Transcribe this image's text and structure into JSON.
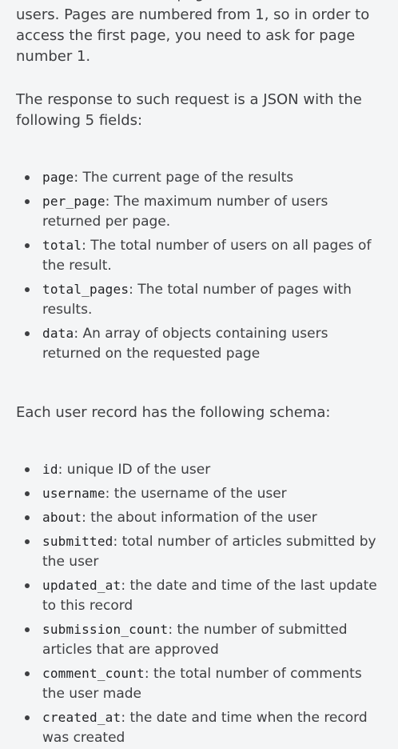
{
  "intro": {
    "pagination_text": "will return the second page of the collection of users. Pages are numbered from 1, so in order to access the first page, you need to ask for page number 1.",
    "response_text": "The response to such request is a JSON with the following 5 fields:"
  },
  "response_fields": [
    {
      "name": "page",
      "desc": ": The current page of the results"
    },
    {
      "name": "per_page",
      "desc": ": The maximum number of users returned per page."
    },
    {
      "name": "total",
      "desc": ": The total number of users on all pages of the result."
    },
    {
      "name": "total_pages",
      "desc": ": The total number of pages with results."
    },
    {
      "name": "data",
      "desc": ": An array of objects containing users returned on the requested page"
    }
  ],
  "schema_intro": "Each user record has the following schema:",
  "user_fields": [
    {
      "name": "id",
      "desc": ": unique ID of the user"
    },
    {
      "name": "username",
      "desc": ": the username of the user"
    },
    {
      "name": "about",
      "desc": ": the about information of the user"
    },
    {
      "name": "submitted",
      "desc": ": total number of articles submitted by the user"
    },
    {
      "name": "updated_at",
      "desc": ": the date and time of the last update to this record"
    },
    {
      "name": "submission_count",
      "desc": ": the number of submitted articles that are approved"
    },
    {
      "name": "comment_count",
      "desc": ": the total number of comments the user made"
    },
    {
      "name": "created_at",
      "desc": ": the date and time when the record was created"
    }
  ]
}
